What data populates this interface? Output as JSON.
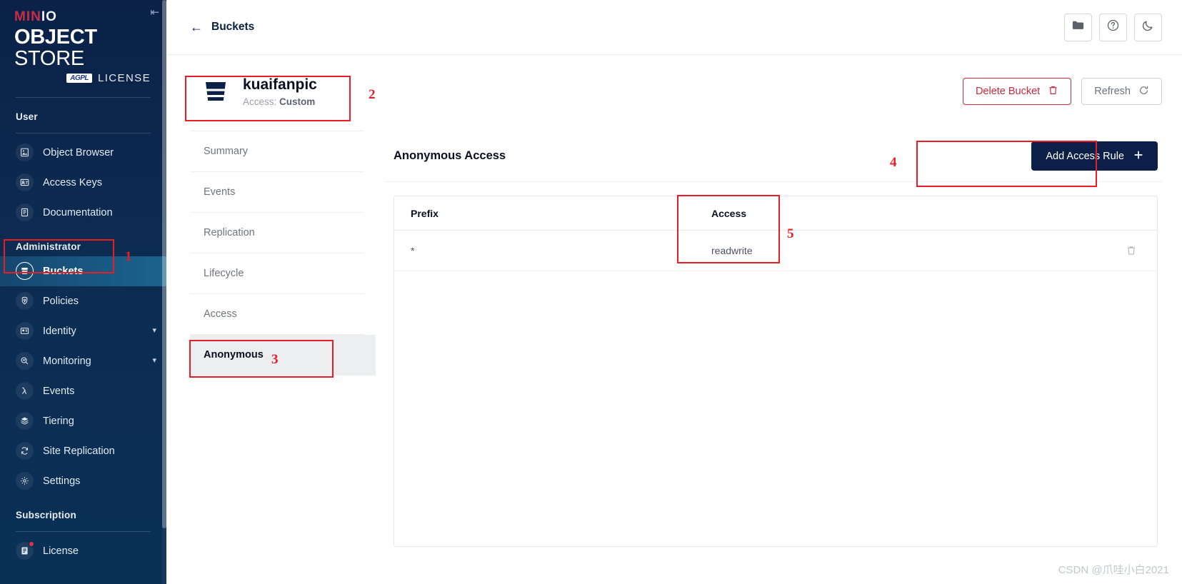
{
  "sidebar": {
    "logo": {
      "minio_prefix": "MIN",
      "minio_suffix": "IO",
      "object": "OBJECT",
      "store": " STORE",
      "agpl_badge": "AGPL",
      "license": "LICENSE"
    },
    "sections": [
      {
        "title": "User"
      },
      {
        "title": "Administrator"
      },
      {
        "title": "Subscription"
      }
    ],
    "user_items": [
      {
        "label": "Object Browser",
        "icon": "object-browser-icon"
      },
      {
        "label": "Access Keys",
        "icon": "access-keys-icon"
      },
      {
        "label": "Documentation",
        "icon": "documentation-icon"
      }
    ],
    "admin_items": [
      {
        "label": "Buckets",
        "icon": "bucket-icon",
        "active": true
      },
      {
        "label": "Policies",
        "icon": "policies-icon"
      },
      {
        "label": "Identity",
        "icon": "identity-icon",
        "chevron": true
      },
      {
        "label": "Monitoring",
        "icon": "monitoring-icon",
        "chevron": true
      },
      {
        "label": "Events",
        "icon": "events-lambda-icon"
      },
      {
        "label": "Tiering",
        "icon": "tiering-layers-icon"
      },
      {
        "label": "Site Replication",
        "icon": "site-replication-icon"
      },
      {
        "label": "Settings",
        "icon": "settings-gear-icon"
      }
    ],
    "subscription_items": [
      {
        "label": "License",
        "icon": "license-icon",
        "badge": true
      }
    ]
  },
  "topbar": {
    "breadcrumb": "Buckets",
    "buttons": [
      {
        "name": "object-browser-folder-button",
        "icon": "folder-icon"
      },
      {
        "name": "help-button",
        "icon": "question-circle-icon"
      },
      {
        "name": "dark-mode-button",
        "icon": "moon-icon"
      }
    ]
  },
  "bucket": {
    "name": "kuaifanpic",
    "access_label": "Access:",
    "access_value": "Custom",
    "delete_button": "Delete Bucket",
    "refresh_button": "Refresh"
  },
  "tabs": [
    {
      "label": "Summary",
      "active": false
    },
    {
      "label": "Events",
      "active": false
    },
    {
      "label": "Replication",
      "active": false
    },
    {
      "label": "Lifecycle",
      "active": false
    },
    {
      "label": "Access",
      "active": false
    },
    {
      "label": "Anonymous",
      "active": true
    }
  ],
  "panel": {
    "title": "Anonymous Access",
    "add_rule_button": "Add Access Rule"
  },
  "table": {
    "columns": [
      "Prefix",
      "Access"
    ],
    "rows": [
      {
        "prefix": "*",
        "access": "readwrite"
      }
    ]
  },
  "annotations": [
    {
      "number": "1",
      "target": "sidebar-item-buckets"
    },
    {
      "number": "2",
      "target": "bucket-header"
    },
    {
      "number": "3",
      "target": "tab-anonymous"
    },
    {
      "number": "4",
      "target": "add-access-rule-button"
    },
    {
      "number": "5",
      "target": "access-column"
    }
  ],
  "watermark": "CSDN @爪哇小白2021",
  "colors": {
    "sidebar_bg": "#0d2c52",
    "accent_red": "#c72c48",
    "primary_navy": "#0b1f48",
    "annotation_red": "#ec1c24"
  }
}
